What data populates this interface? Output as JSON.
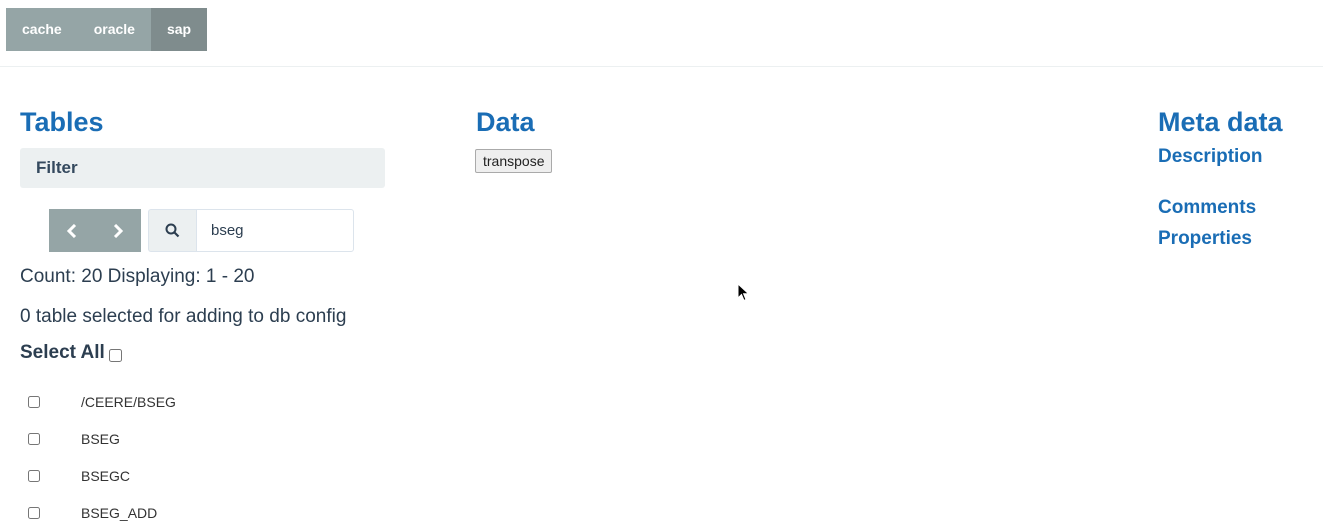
{
  "nav": {
    "tabs": [
      {
        "label": "cache"
      },
      {
        "label": "oracle"
      },
      {
        "label": "sap"
      }
    ],
    "active": "sap"
  },
  "tables": {
    "title": "Tables",
    "filter_label": "Filter",
    "search_value": "bseg",
    "count_text": "Count: 20 Displaying: 1 - 20",
    "selected_text": "0 table selected for adding to db config",
    "select_all_label": "Select All",
    "rows": [
      {
        "name": "/CEERE/BSEG"
      },
      {
        "name": "BSEG"
      },
      {
        "name": "BSEGC"
      },
      {
        "name": "BSEG_ADD"
      }
    ]
  },
  "data_section": {
    "title": "Data",
    "transpose_label": "transpose"
  },
  "meta": {
    "title": "Meta data",
    "description": "Description",
    "comments": "Comments",
    "properties": "Properties"
  },
  "colors": {
    "accent": "#1a6db5",
    "nav_bg": "#95a5a6",
    "nav_active": "#7f8c8d",
    "filter_bg": "#ecf0f1"
  }
}
